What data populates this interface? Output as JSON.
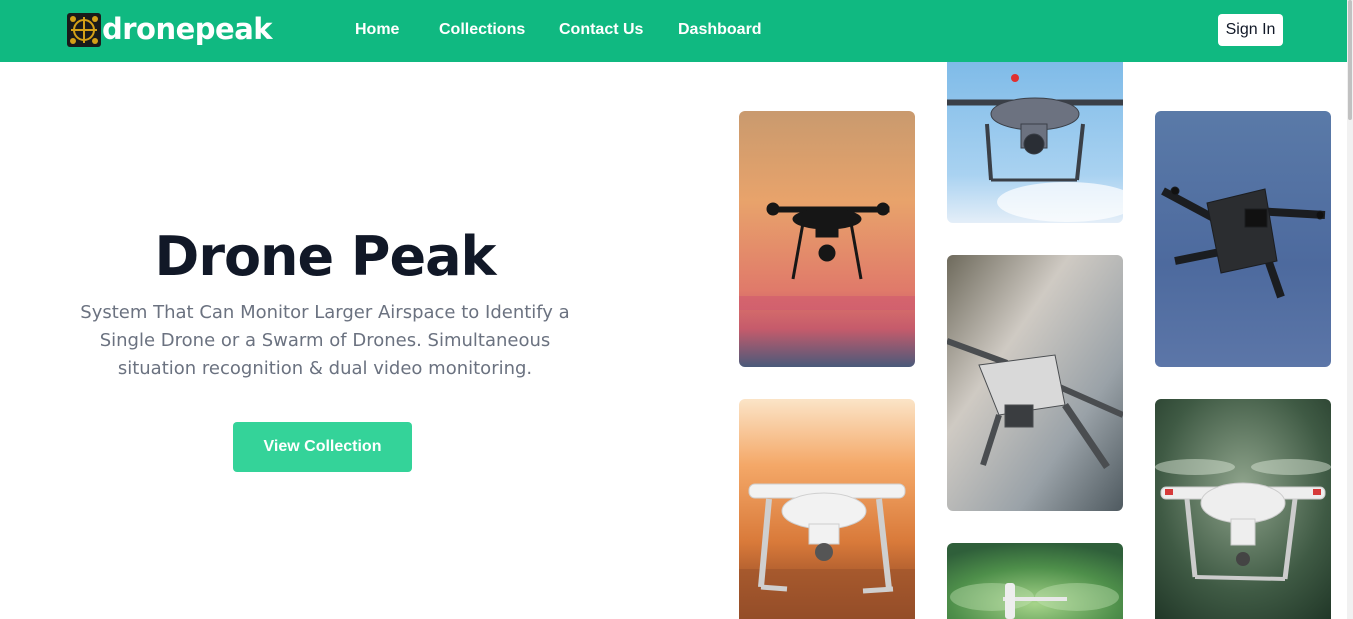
{
  "nav": {
    "brand": "dronepeak",
    "logo_icon": "drone-crosshair-logo-icon",
    "links": [
      {
        "label": "Home"
      },
      {
        "label": "Collections"
      },
      {
        "label": "Contact Us"
      },
      {
        "label": "Dashboard"
      }
    ],
    "sign_in": "Sign In"
  },
  "hero": {
    "title": "Drone Peak",
    "description": "System That Can Monitor Larger Airspace to Identify a Single Drone or a Swarm of Drones. Simultaneous situation recognition & dual video monitoring.",
    "cta": "View Collection"
  },
  "gallery": {
    "images": [
      "drone-silhouette-sunset-image",
      "drone-blue-sky-image",
      "drone-foldable-dark-image",
      "drone-sunset-field-image",
      "drone-foldable-gray-image",
      "drone-white-forest-image",
      "drone-green-propeller-image"
    ]
  },
  "colors": {
    "primary": "#10b981",
    "accent": "#34d399",
    "heading": "#111827",
    "muted": "#6b7280"
  }
}
